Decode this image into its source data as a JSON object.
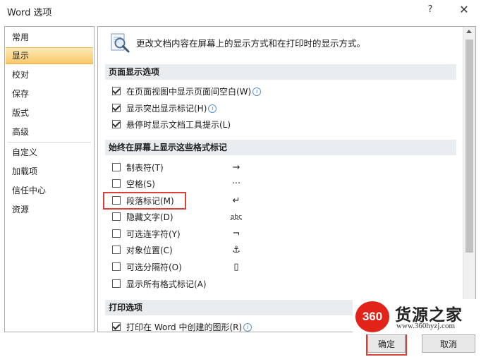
{
  "window": {
    "title": "Word 选项",
    "help_icon": "?",
    "close_icon": "✕"
  },
  "nav": {
    "items": [
      {
        "label": "常用"
      },
      {
        "label": "显示",
        "selected": true
      },
      {
        "label": "校对"
      },
      {
        "label": "保存"
      },
      {
        "label": "版式"
      },
      {
        "label": "高级"
      },
      {
        "label": "自定义"
      },
      {
        "label": "加载项"
      },
      {
        "label": "信任中心"
      },
      {
        "label": "资源"
      }
    ]
  },
  "content": {
    "header_text": "更改文档内容在屏幕上的显示方式和在打印时的显示方式。",
    "page_display": {
      "title": "页面显示选项",
      "options": [
        {
          "label": "在页面视图中显示页面间空白(W)",
          "checked": true,
          "info": true
        },
        {
          "label": "显示突出显示标记(H)",
          "checked": true,
          "info": true
        },
        {
          "label": "悬停时显示文档工具提示(L)",
          "checked": true,
          "info": false
        }
      ]
    },
    "formatting_marks": {
      "title": "始终在屏幕上显示这些格式标记",
      "options": [
        {
          "label": "制表符(T)",
          "checked": false,
          "symbol": "→"
        },
        {
          "label": "空格(S)",
          "checked": false,
          "symbol": "···"
        },
        {
          "label": "段落标记(M)",
          "checked": false,
          "symbol": "↵"
        },
        {
          "label": "隐藏文字(D)",
          "checked": false,
          "symbol": "abc"
        },
        {
          "label": "可选连字符(Y)",
          "checked": false,
          "symbol": "¬"
        },
        {
          "label": "对象位置(C)",
          "checked": false,
          "symbol": "⚓"
        },
        {
          "label": "可选分隔符(O)",
          "checked": false,
          "symbol": "▯"
        },
        {
          "label": "显示所有格式标记(A)",
          "checked": false,
          "symbol": ""
        }
      ]
    },
    "print_options": {
      "title": "打印选项",
      "options": [
        {
          "label": "打印在 Word 中创建的图形(R)",
          "checked": true,
          "info": true
        }
      ]
    }
  },
  "buttons": {
    "ok": "确定",
    "cancel": "取消"
  },
  "watermark": {
    "logo": "360",
    "name": "货源之家",
    "url": "www.360hyzj.com"
  },
  "colors": {
    "highlight": "#d9413a",
    "selected_nav": "#f8c868",
    "section_bg": "#e9ecef"
  }
}
